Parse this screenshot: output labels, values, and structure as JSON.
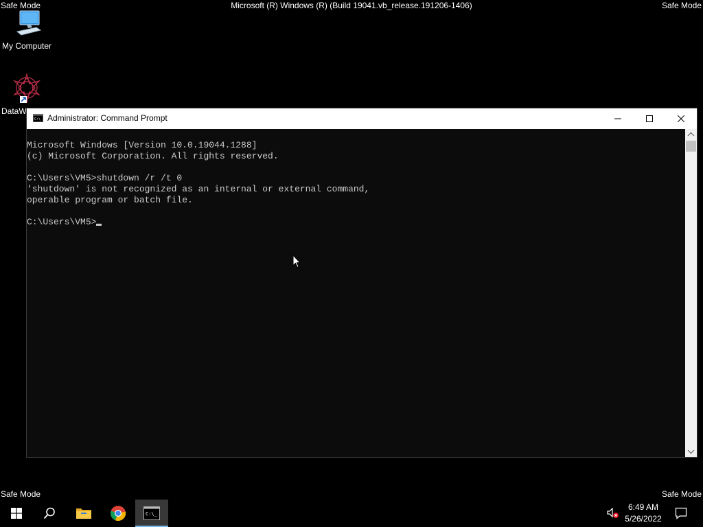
{
  "desktop": {
    "safe_mode_label": "Safe Mode",
    "build_title": "Microsoft (R) Windows (R) (Build 19041.vb_release.191206-1406)",
    "icons": [
      {
        "label": "My Computer",
        "icon": "computer-icon"
      },
      {
        "label": "DataW",
        "icon": "datawrapper-shortcut-icon"
      }
    ]
  },
  "window": {
    "title": "Administrator: Command Prompt",
    "controls": [
      "minimize",
      "maximize",
      "close"
    ],
    "console_lines": [
      "Microsoft Windows [Version 10.0.19044.1288]",
      "(c) Microsoft Corporation. All rights reserved.",
      "",
      "C:\\Users\\VM5>shutdown /r /t 0",
      "'shutdown' is not recognized as an internal or external command,",
      "operable program or batch file.",
      ""
    ],
    "prompt": "C:\\Users\\VM5>"
  },
  "taskbar": {
    "items": [
      "start",
      "search",
      "file-explorer",
      "chrome",
      "command-prompt"
    ],
    "time": "6:49 AM",
    "date": "5/26/2022"
  },
  "colors": {
    "desktop_bg": "#000000",
    "console_bg": "#0c0c0c",
    "console_text": "#cccccc",
    "titlebar_bg": "#ffffff",
    "taskbar_active": "#383838",
    "accent": "#76b9ed"
  }
}
